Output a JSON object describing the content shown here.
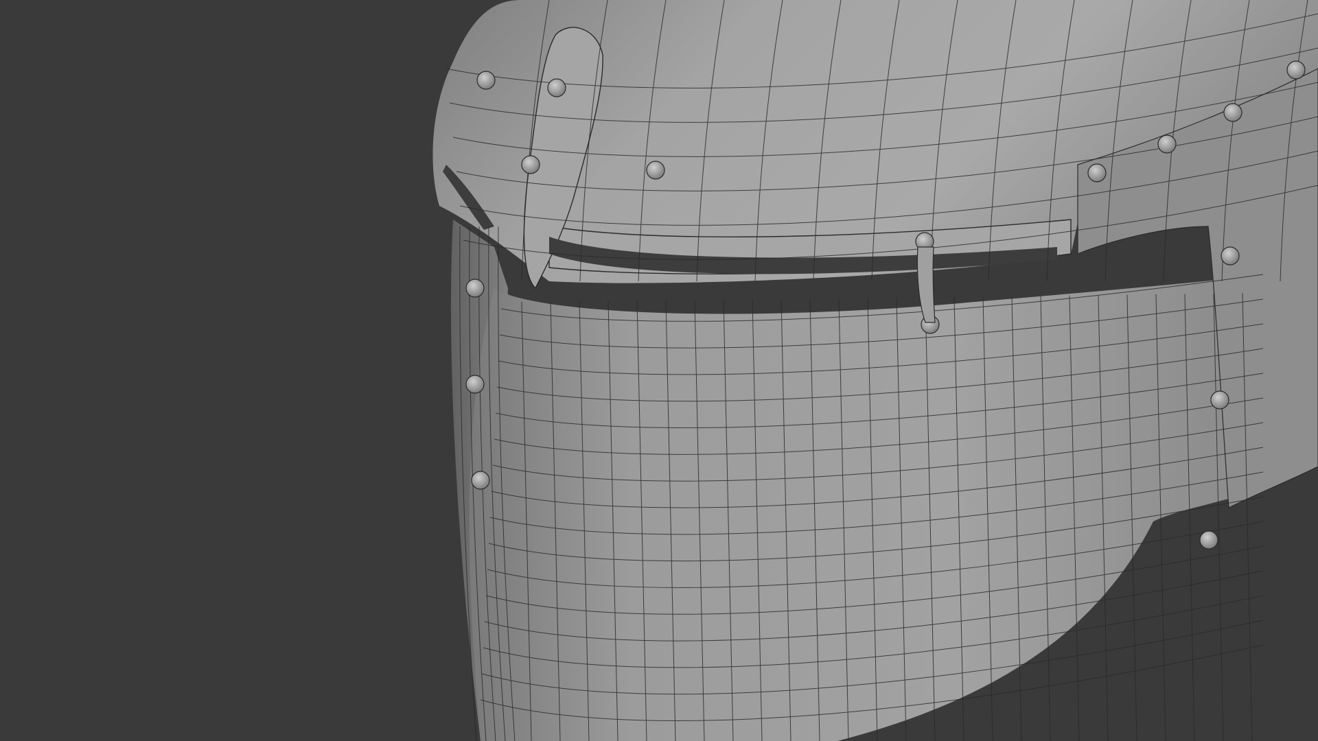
{
  "viewport": {
    "background_color": "#3a3a3a",
    "object_name": "",
    "shading_mode": "solid",
    "overlay": "wireframe"
  },
  "model": {
    "subject": "great helm",
    "surface_color": "#9a9a9a",
    "highlight_color": "#b8b8b8",
    "shadow_color": "#5e5e5e",
    "wire_color": "#2a2a2a",
    "rivet_color": "#a8a8a8",
    "slit_color": "#3d3d3d",
    "rivet_count": 16
  }
}
